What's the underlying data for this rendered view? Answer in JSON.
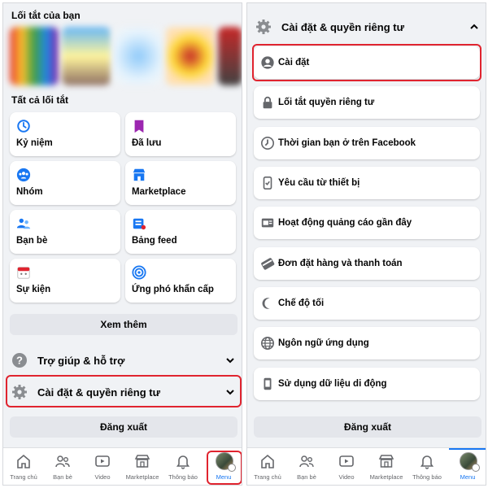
{
  "left": {
    "shortcuts_title": "Lối tắt của bạn",
    "all_shortcuts_title": "Tất cả lối tắt",
    "tiles": [
      {
        "label": "Kỷ niệm",
        "icon": "clock-history-icon"
      },
      {
        "label": "Đã lưu",
        "icon": "bookmark-icon"
      },
      {
        "label": "Nhóm",
        "icon": "groups-icon"
      },
      {
        "label": "Marketplace",
        "icon": "marketplace-icon"
      },
      {
        "label": "Bạn bè",
        "icon": "friends-icon"
      },
      {
        "label": "Bảng feed",
        "icon": "feed-icon"
      },
      {
        "label": "Sự kiện",
        "icon": "calendar-icon"
      },
      {
        "label": "Ứng phó khẩn cấp",
        "icon": "crisis-response-icon"
      }
    ],
    "see_more": "Xem thêm",
    "help": {
      "label": "Trợ giúp & hỗ trợ",
      "icon": "question-icon"
    },
    "settings": {
      "label": "Cài đặt & quyền riêng tư",
      "icon": "gear-icon"
    },
    "logout": "Đăng xuất"
  },
  "right": {
    "header": {
      "label": "Cài đặt & quyền riêng tư",
      "icon": "gear-icon"
    },
    "items": [
      {
        "label": "Cài đặt",
        "icon": "user-settings-icon"
      },
      {
        "label": "Lối tắt quyền riêng tư",
        "icon": "lock-icon"
      },
      {
        "label": "Thời gian bạn ở trên Facebook",
        "icon": "hourglass-icon"
      },
      {
        "label": "Yêu cầu từ thiết bị",
        "icon": "device-icon"
      },
      {
        "label": "Hoạt động quảng cáo gần đây",
        "icon": "ad-activity-icon"
      },
      {
        "label": "Đơn đặt hàng và thanh toán",
        "icon": "payment-card-icon"
      },
      {
        "label": "Chế độ tối",
        "icon": "moon-icon"
      },
      {
        "label": "Ngôn ngữ ứng dụng",
        "icon": "globe-icon"
      },
      {
        "label": "Sử dụng dữ liệu di động",
        "icon": "mobile-data-icon"
      }
    ],
    "logout": "Đăng xuất"
  },
  "tabs": [
    {
      "label": "Trang chủ",
      "icon": "home-icon"
    },
    {
      "label": "Bạn bè",
      "icon": "friends-icon"
    },
    {
      "label": "Video",
      "icon": "video-icon"
    },
    {
      "label": "Marketplace",
      "icon": "marketplace-icon"
    },
    {
      "label": "Thông báo",
      "icon": "bell-icon"
    },
    {
      "label": "Menu",
      "icon": "avatar"
    }
  ],
  "colors": {
    "accent": "#1877f2",
    "highlight": "#e0242f",
    "background": "#f0f2f5"
  }
}
